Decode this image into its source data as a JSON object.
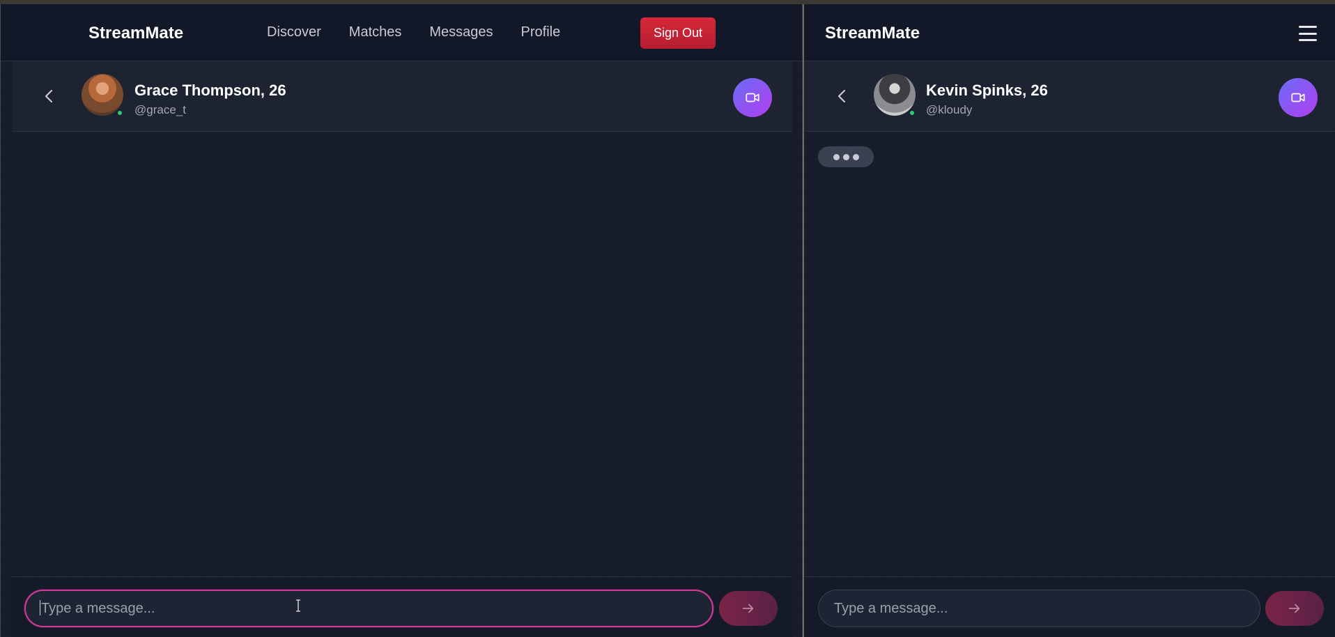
{
  "left": {
    "brand": "StreamMate",
    "nav": [
      "Discover",
      "Matches",
      "Messages",
      "Profile"
    ],
    "sign_out": "Sign Out",
    "contact": {
      "name": "Grace Thompson, 26",
      "handle": "@grace_t"
    },
    "composer": {
      "placeholder": "Type a message..."
    }
  },
  "right": {
    "brand": "StreamMate",
    "contact": {
      "name": "Kevin Spinks, 26",
      "handle": "@kloudy"
    },
    "composer": {
      "placeholder": "Type a message..."
    }
  },
  "icons": {
    "back": "chevron-left-icon",
    "video": "video-camera-icon",
    "send": "arrow-right-icon",
    "menu": "hamburger-menu-icon"
  },
  "colors": {
    "background": "#151a28",
    "sign_out": "#d6283a",
    "video_button_gradient": [
      "#6a6cf5",
      "#b13ef0"
    ],
    "input_focus_border": "#d23a9a",
    "online": "#2ecc71"
  }
}
